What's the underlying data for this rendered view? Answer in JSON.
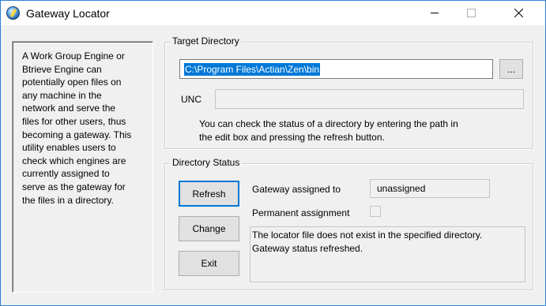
{
  "window": {
    "title": "Gateway Locator"
  },
  "info": {
    "text": "A Work Group Engine or\nBtrieve Engine can\npotentially open files on\nany machine in the\nnetwork and serve the\nfiles for other users, thus\nbecoming a gateway. This\nutility enables users to\ncheck which engines are\ncurrently assigned to\nserve as the gateway for\nthe files in a directory."
  },
  "target_directory": {
    "group_label": "Target Directory",
    "directory_value": "C:\\Program Files\\Actian\\Zen\\bin",
    "browse_label": "...",
    "unc_label": "UNC",
    "unc_value": "",
    "hint": "You can check the status of a directory by entering the path in\nthe edit box and pressing the refresh button."
  },
  "directory_status": {
    "group_label": "Directory Status",
    "refresh_label": "Refresh",
    "change_label": "Change",
    "exit_label": "Exit",
    "gateway_label": "Gateway assigned to",
    "gateway_value": "unassigned",
    "permanent_label": "Permanent assignment",
    "permanent_checked": false,
    "status_messages": "The locator file does not exist in the specified directory.\nGateway status refreshed."
  },
  "icons": {
    "app": "gateway-locator-app-icon",
    "minimize": "minimize-icon",
    "maximize": "maximize-icon",
    "close": "close-icon"
  },
  "colors": {
    "selection": "#0078d7",
    "window_border": "#2b7fd6",
    "face": "#f0f0f0"
  }
}
